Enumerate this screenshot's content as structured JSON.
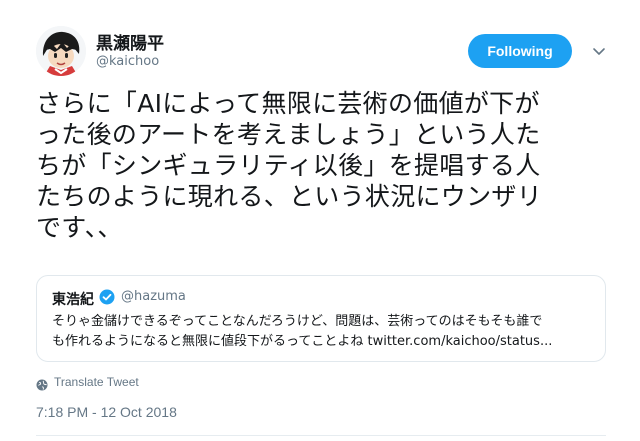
{
  "author": {
    "name": "黒瀬陽平",
    "handle": "@kaichoo"
  },
  "follow_button": {
    "label": "Following"
  },
  "tweet": {
    "lines": [
      "さらに「AIによって無限に芸術の価値が下が",
      "った後のアートを考えましょう」という人た",
      "ちが「シンギュラリティ以後」を提唱する人",
      "たちのように現れる、という状況にウンザリ",
      "です、、"
    ]
  },
  "quoted_tweet": {
    "name": "東浩紀",
    "verified": true,
    "handle": "@hazuma",
    "line1": "そりゃ金儲けできるぞってことなんだろうけど、問題は、芸術ってのはそもそも誰で",
    "line2_text": "も作れるようになると無限に値段下がるってことよね ",
    "line2_link": "twitter.com/kaichoo/status..."
  },
  "translate": {
    "label": "Translate Tweet",
    "icon": "globe-icon"
  },
  "timestamp": "7:18 PM - 12 Oct 2018",
  "colors": {
    "accent": "#1da1f2",
    "secondary_text": "#657786",
    "border": "#e1e8ed"
  }
}
